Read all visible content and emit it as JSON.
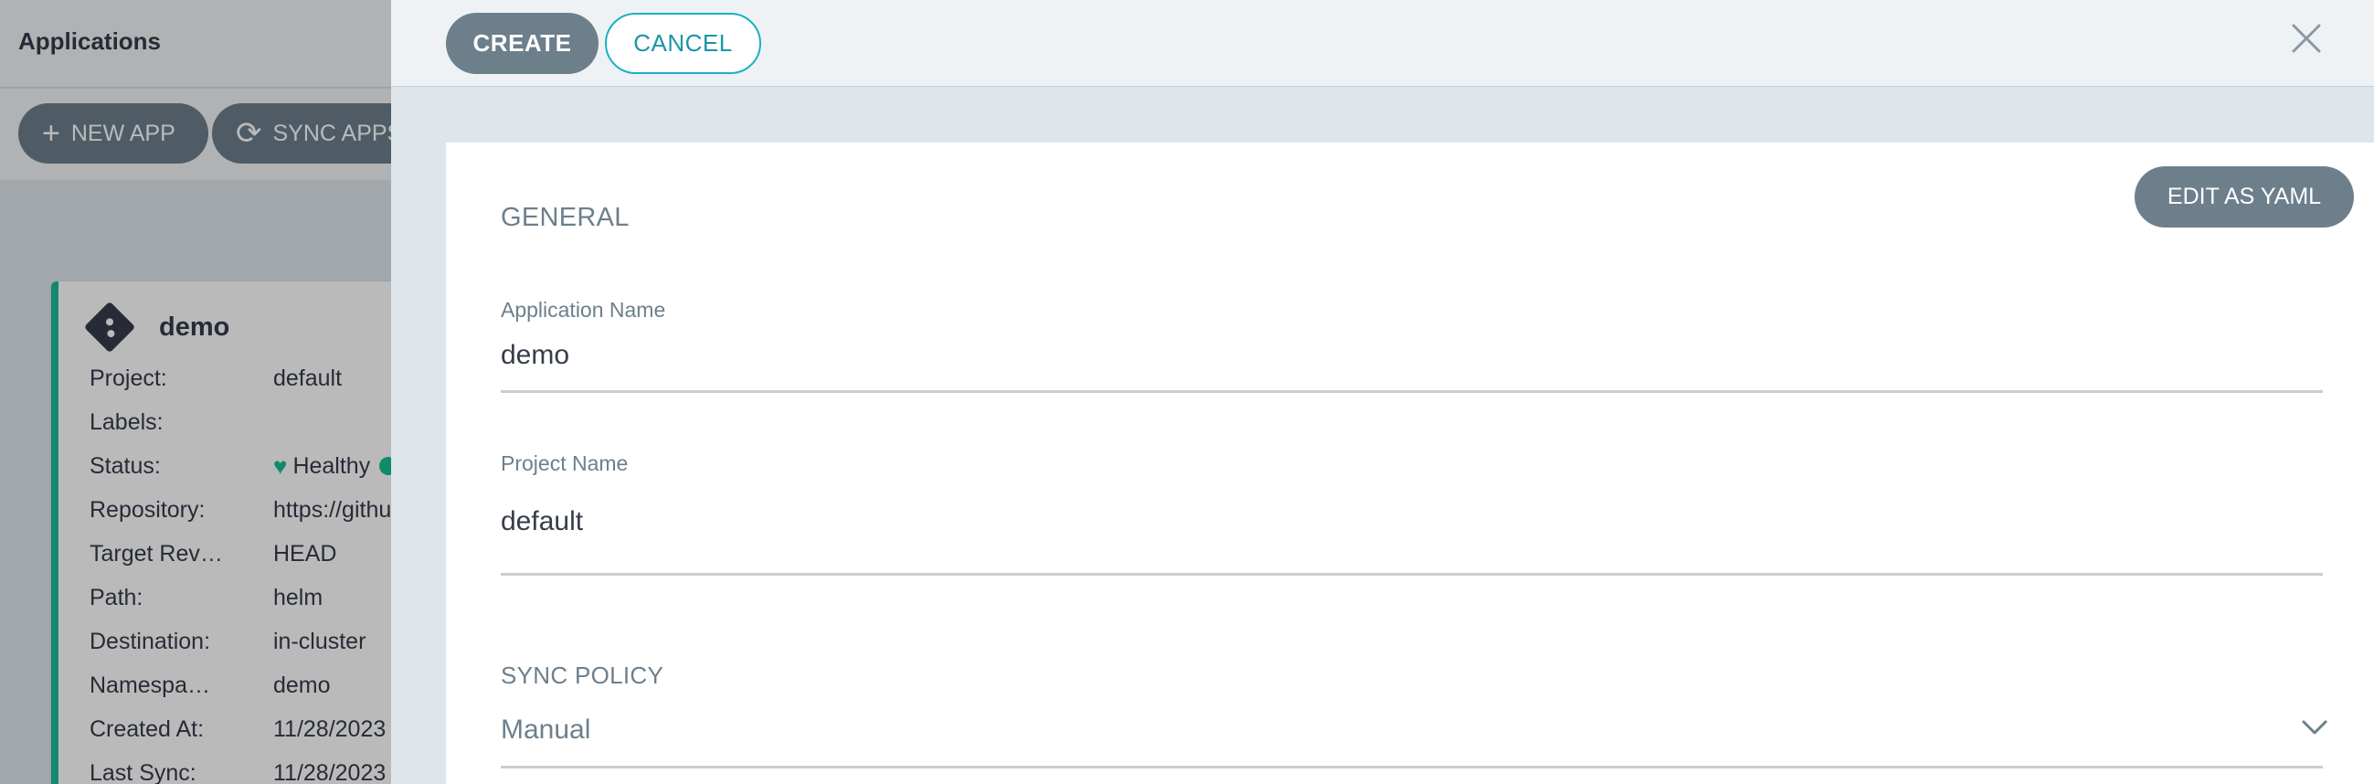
{
  "app": {
    "title": "Applications"
  },
  "toolbar": {
    "new_app_icon": "plus-icon",
    "new_app_label": "NEW APP",
    "sync_apps_icon": "sync-icon",
    "sync_apps_label": "SYNC APPS"
  },
  "card": {
    "icon": "git-icon",
    "name": "demo",
    "rows": [
      {
        "key": "Project:",
        "value": "default"
      },
      {
        "key": "Labels:",
        "value": ""
      },
      {
        "key": "Status:",
        "value": "Healthy"
      },
      {
        "key": "Repository:",
        "value": "https://githu"
      },
      {
        "key": "Target Rev…",
        "value": "HEAD"
      },
      {
        "key": "Path:",
        "value": "helm"
      },
      {
        "key": "Destination:",
        "value": "in-cluster"
      },
      {
        "key": "Namespa…",
        "value": "demo"
      },
      {
        "key": "Created At:",
        "value": "11/28/2023"
      },
      {
        "key": "Last Sync:",
        "value": "11/28/2023"
      }
    ]
  },
  "panel": {
    "create_label": "CREATE",
    "cancel_label": "CANCEL",
    "close_icon": "close-icon",
    "edit_yaml_label": "EDIT AS YAML",
    "general_title": "GENERAL",
    "app_name_label": "Application Name",
    "app_name_value": "demo",
    "project_name_label": "Project Name",
    "project_name_value": "default",
    "sync_policy_title": "SYNC POLICY",
    "sync_policy_value": "Manual"
  },
  "colors": {
    "primary_button": "#6d7f8b",
    "accent_teal": "#1ab0c6",
    "healthy_green": "#18be94",
    "text_dark": "#363c4a",
    "text_muted": "#6d7f8b"
  }
}
